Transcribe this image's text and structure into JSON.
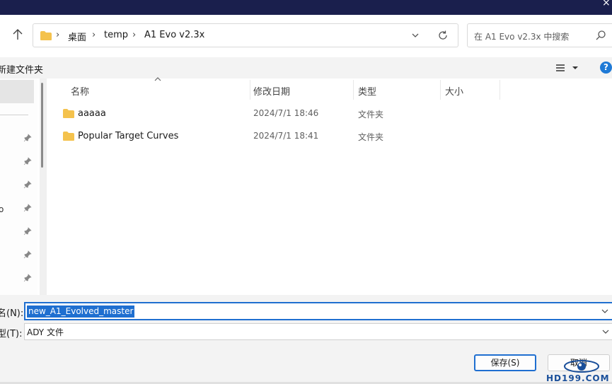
{
  "title_bar": {
    "close_glyph": "×"
  },
  "address": {
    "crumbs": [
      "桌面",
      "temp",
      "A1 Evo v2.3x"
    ],
    "separator": "›"
  },
  "search": {
    "placeholder": "在 A1 Evo v2.3x 中搜索"
  },
  "toolbar": {
    "new_folder": "新建文件夹",
    "help": "?"
  },
  "columns": [
    "名称",
    "修改日期",
    "类型",
    "大小"
  ],
  "files": [
    {
      "name": "aaaaa",
      "modified": "2024/7/1 18:46",
      "type": "文件夹"
    },
    {
      "name": "Popular Target Curves",
      "modified": "2024/7/1 18:41",
      "type": "文件夹"
    }
  ],
  "nav_fragment": "o",
  "form": {
    "filename_label": "名(N):",
    "filename_value": "new_A1_Evolved_master",
    "filetype_label": "型(T):",
    "filetype_value": "ADY 文件"
  },
  "buttons": {
    "save": "保存(S)",
    "cancel": "取消"
  },
  "watermark": {
    "text": "HD199.COM"
  },
  "colors": {
    "accent": "#1f6fd0",
    "titlebar": "#1a1f4d",
    "folder": "#f4c24d"
  }
}
